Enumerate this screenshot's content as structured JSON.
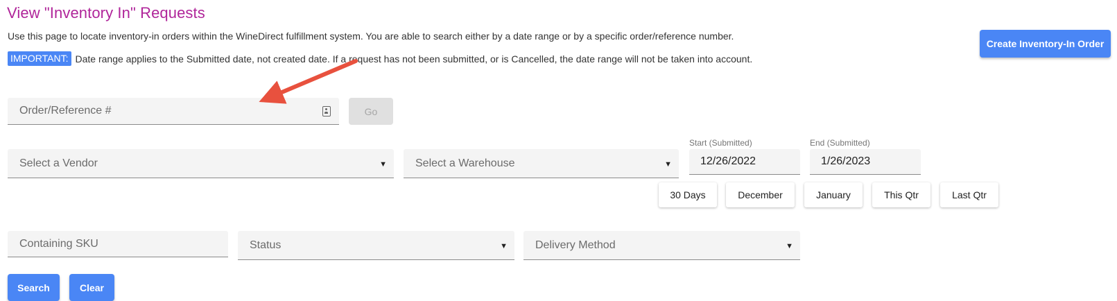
{
  "header": {
    "title": "View \"Inventory In\" Requests",
    "description": "Use this page to locate inventory-in orders within the WineDirect fulfillment system. You are able to search either by a date range or by a specific order/reference number.",
    "important_badge": "IMPORTANT:",
    "important_text": "Date range applies to the Submitted date, not created date. If a request has not been submitted, or is Cancelled, the date range will not be taken into account.",
    "create_button": "Create Inventory-In Order"
  },
  "order_search": {
    "placeholder": "Order/Reference #",
    "go_button": "Go"
  },
  "filters": {
    "vendor_placeholder": "Select a Vendor",
    "warehouse_placeholder": "Select a Warehouse",
    "start_label": "Start (Submitted)",
    "start_value": "12/26/2022",
    "end_label": "End (Submitted)",
    "end_value": "1/26/2023",
    "quick_ranges": [
      "30 Days",
      "December",
      "January",
      "This Qtr",
      "Last Qtr"
    ],
    "sku_placeholder": "Containing SKU",
    "status_placeholder": "Status",
    "delivery_placeholder": "Delivery Method"
  },
  "actions": {
    "search_button": "Search",
    "clear_button": "Clear"
  },
  "colors": {
    "title": "#b0259a",
    "primary": "#4a86f5",
    "annotation_arrow": "#e8513e"
  },
  "icons": {
    "order_field_icon": "contact-card-icon",
    "annotation": "red-arrow-annotation",
    "dropdown": "caret-down-icon"
  }
}
